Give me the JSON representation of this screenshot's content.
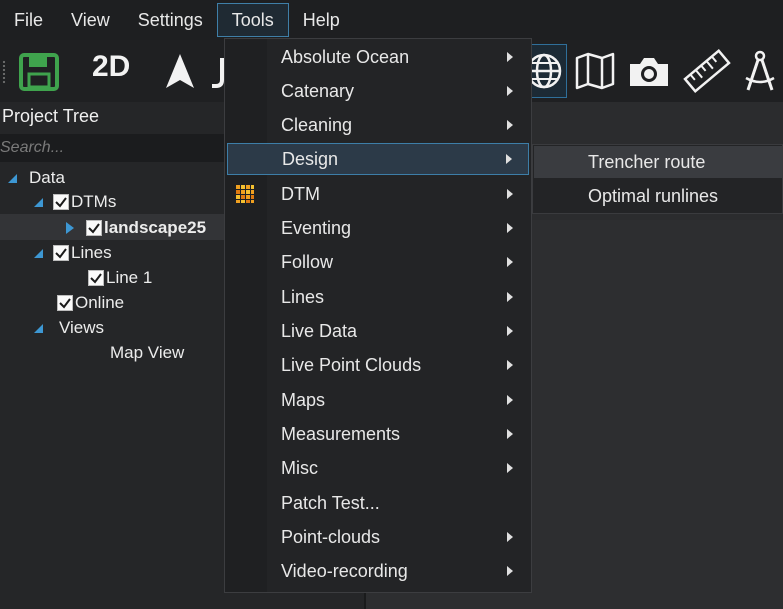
{
  "menubar": {
    "items": [
      "File",
      "View",
      "Settings",
      "Tools",
      "Help"
    ],
    "active": "Tools"
  },
  "toolbar": {
    "label_2d": "2D",
    "icons": [
      "save-icon",
      "2d-view-button",
      "north-arrow-icon",
      "globe-icon",
      "map-icon",
      "camera-icon",
      "ruler-icon",
      "compass-icon"
    ]
  },
  "project_tree": {
    "title": "Project Tree",
    "search_placeholder": "Search...",
    "nodes": {
      "data": "Data",
      "dtms": "DTMs",
      "landscape": "landscape25",
      "lines": "Lines",
      "line1": "Line 1",
      "online": "Online",
      "views": "Views",
      "map_view": "Map View"
    }
  },
  "tools_menu": {
    "items": [
      {
        "label": "Absolute Ocean",
        "submenu": true
      },
      {
        "label": "Catenary",
        "submenu": true
      },
      {
        "label": "Cleaning",
        "submenu": true
      },
      {
        "label": "Design",
        "submenu": true
      },
      {
        "label": "DTM",
        "submenu": true
      },
      {
        "label": "Eventing",
        "submenu": true
      },
      {
        "label": "Follow",
        "submenu": true
      },
      {
        "label": "Lines",
        "submenu": true
      },
      {
        "label": "Live Data",
        "submenu": true
      },
      {
        "label": "Live Point Clouds",
        "submenu": true
      },
      {
        "label": "Maps",
        "submenu": true
      },
      {
        "label": "Measurements",
        "submenu": true
      },
      {
        "label": "Misc",
        "submenu": true
      },
      {
        "label": "Patch Test...",
        "submenu": false
      },
      {
        "label": "Point-clouds",
        "submenu": true
      },
      {
        "label": "Video-recording",
        "submenu": true
      }
    ],
    "highlighted": "Design"
  },
  "design_submenu": {
    "items": [
      "Trencher route",
      "Optimal runlines"
    ],
    "highlighted": "Trencher route"
  },
  "colors": {
    "accent": "#3d97d3",
    "menu_highlight_border": "#3d7ea8",
    "save_icon": "#3fa34d"
  }
}
